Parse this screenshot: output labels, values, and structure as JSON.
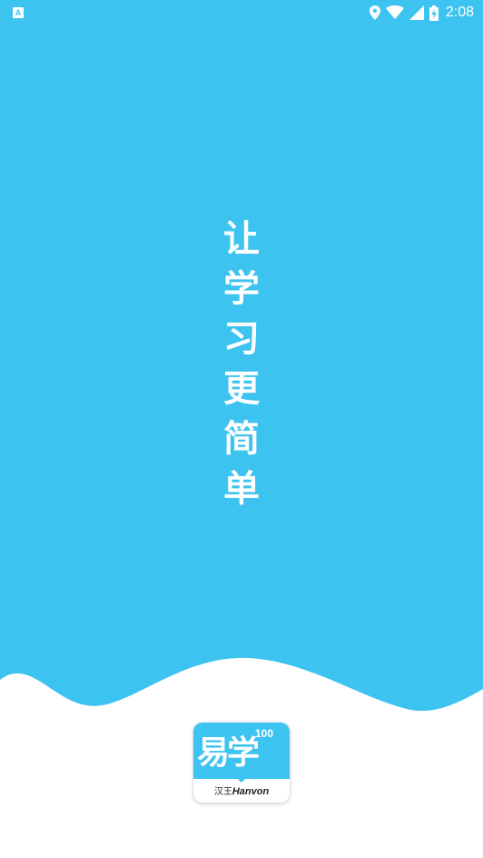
{
  "status_bar": {
    "notification_letter": "A",
    "time": "2:08",
    "icons": [
      "location-icon",
      "wifi-icon",
      "signal-icon",
      "battery-charging-icon"
    ]
  },
  "splash": {
    "background_color": "#3cc3f0",
    "slogan_chars": [
      "让",
      "学",
      "习",
      "更",
      "简",
      "单"
    ]
  },
  "logo": {
    "main_text": "易学",
    "number": "100",
    "brand_cn": "汉王",
    "brand_en": "Hanvon"
  }
}
